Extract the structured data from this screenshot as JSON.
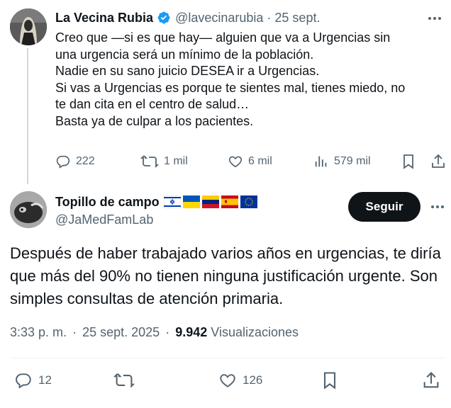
{
  "parent_tweet": {
    "display_name": "La Vecina Rubia",
    "handle": "@lavecinarubia",
    "separator": "·",
    "date": "25 sept.",
    "body_lines": [
      "Creo que —si es que hay— alguien que va a Urgencias sin",
      "una urgencia será un mínimo de la población.",
      "Nadie en su sano juicio DESEA ir a Urgencias.",
      "Si vas a Urgencias es porque te sientes mal, tienes miedo, no",
      "te dan cita en el centro de salud…",
      "Basta ya de culpar a los pacientes."
    ],
    "actions": {
      "replies": "222",
      "reposts": "1 mil",
      "likes": "6 mil",
      "views": "579 mil"
    }
  },
  "reply_tweet": {
    "display_name": "Topillo de campo",
    "flags": [
      "israel-flag",
      "ukraine-flag",
      "venezuela-flag",
      "spain-flag",
      "eu-flag"
    ],
    "handle": "@JaMedFamLab",
    "follow_label": "Seguir",
    "body": "Después de haber trabajado varios años en urgencias, te diría que más del 90% no tienen ninguna justificación urgente. Son simples consultas de atención primaria.",
    "time": "3:33 p. m.",
    "separator": "·",
    "date": "25 sept. 2025",
    "views_count": "9.942",
    "views_label": "Visualizaciones",
    "actions": {
      "replies": "12",
      "likes": "126"
    }
  },
  "colors": {
    "text": "#0f1419",
    "muted": "#536471",
    "verified": "#1d9bf0",
    "thread_line": "#cfd9de",
    "follow_bg": "#0f1419"
  }
}
